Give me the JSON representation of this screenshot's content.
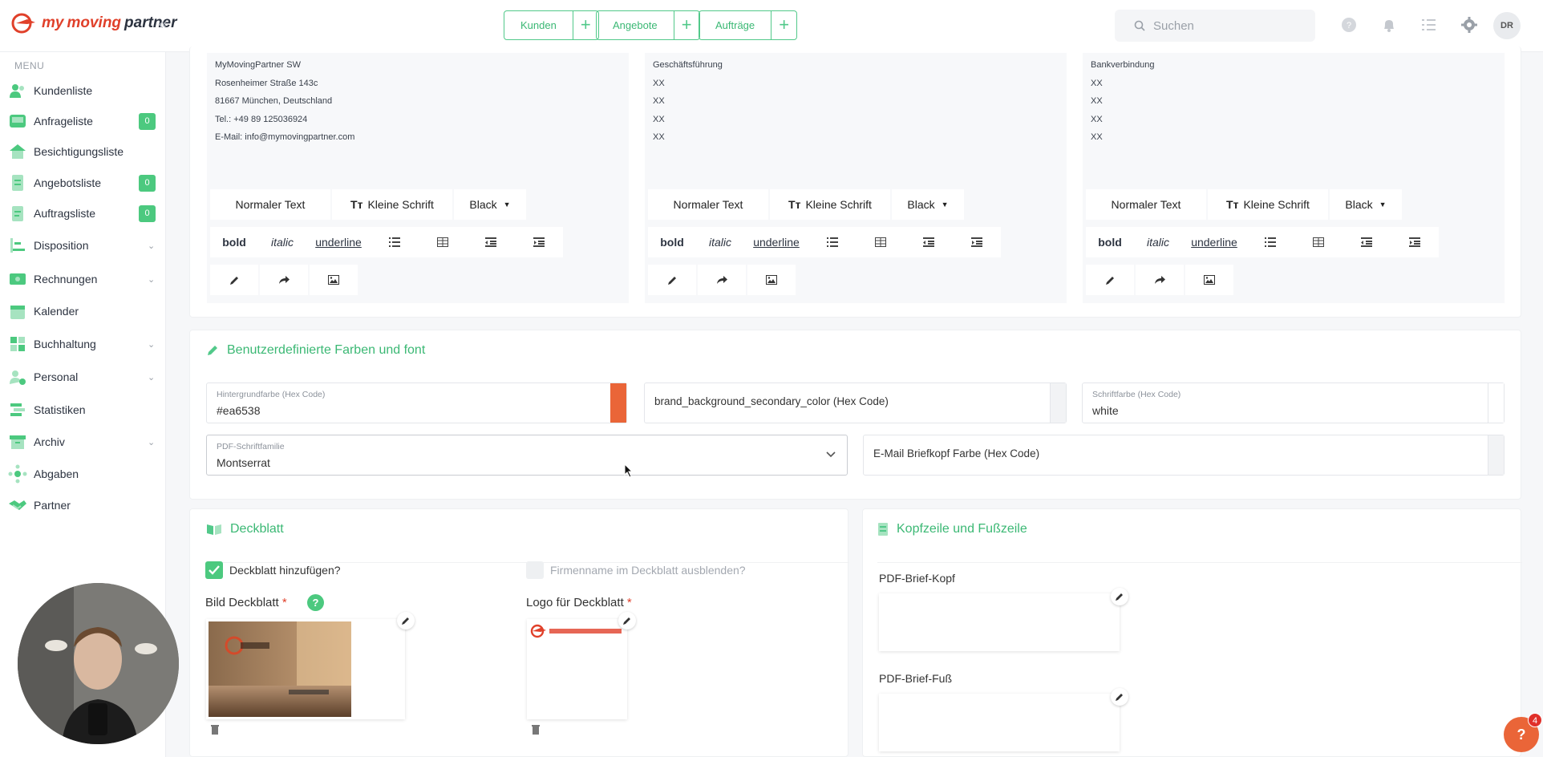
{
  "brand": {
    "name_part1": "my",
    "name_part2": "moving",
    "name_part3": "partner",
    "accent": "#3bb874",
    "primary": "#ea6538"
  },
  "topbar": {
    "quick": [
      {
        "label": "Kunden"
      },
      {
        "label": "Angebote"
      },
      {
        "label": "Aufträge"
      }
    ],
    "search_placeholder": "Suchen",
    "avatar": "DR"
  },
  "sidebar": {
    "menu_heading": "MENU",
    "items": [
      {
        "label": "Kundenliste"
      },
      {
        "label": "Anfrageliste",
        "badge": "0"
      },
      {
        "label": "Besichtigungsliste"
      },
      {
        "label": "Angebotsliste",
        "badge": "0"
      },
      {
        "label": "Auftragsliste",
        "badge": "0"
      },
      {
        "label": "Disposition",
        "chevron": "⌄"
      },
      {
        "label": "Rechnungen",
        "chevron": "⌄"
      },
      {
        "label": "Kalender"
      },
      {
        "label": "Buchhaltung",
        "chevron": "⌄"
      },
      {
        "label": "Personal",
        "chevron": "⌄"
      },
      {
        "label": "Statistiken"
      },
      {
        "label": "Archiv",
        "chevron": "⌄"
      },
      {
        "label": "Abgaben"
      },
      {
        "label": "Partner"
      }
    ]
  },
  "editors": [
    {
      "lines": [
        "MyMovingPartner SW",
        "Rosenheimer Straße 143c",
        "81667 München, Deutschland",
        "Tel.: +49 89 125036924",
        "E-Mail: info@mymovingpartner.com"
      ]
    },
    {
      "lines": [
        "Geschäftsführung",
        "XX",
        "XX",
        "XX",
        "XX"
      ]
    },
    {
      "lines": [
        "Bankverbindung",
        "XX",
        "XX",
        "XX",
        "XX"
      ]
    }
  ],
  "toolbar": {
    "normal": "Normaler Text",
    "small": "Kleine Schrift",
    "color": "Black",
    "bold": "bold",
    "italic": "italic",
    "underline": "underline",
    "small_icon": "Tт"
  },
  "colors_section": {
    "title": "Benutzerdefinierte Farben und font",
    "bg_label": "Hintergrundfarbe (Hex Code)",
    "bg_value": "#ea6538",
    "bg_swatch": "#ea6538",
    "secondary_label": "brand_background_secondary_color (Hex Code)",
    "font_label": "Schriftfarbe (Hex Code)",
    "font_value": "white",
    "pdf_font_label": "PDF-Schriftfamilie",
    "pdf_font_value": "Montserrat",
    "email_label": "E-Mail Briefkopf Farbe (Hex Code)"
  },
  "deckblatt": {
    "title": "Deckblatt",
    "add_label": "Deckblatt hinzufügen?",
    "hide_label": "Firmenname im Deckblatt ausblenden?",
    "bild_label": "Bild Deckblatt",
    "logo_label": "Logo für Deckblatt",
    "required": "*",
    "help": "?"
  },
  "kopf": {
    "title": "Kopfzeile und Fußzeile",
    "kopf_label": "PDF-Brief-Kopf",
    "fuss_label": "PDF-Brief-Fuß"
  },
  "chat": {
    "badge": "4",
    "icon": "?"
  }
}
